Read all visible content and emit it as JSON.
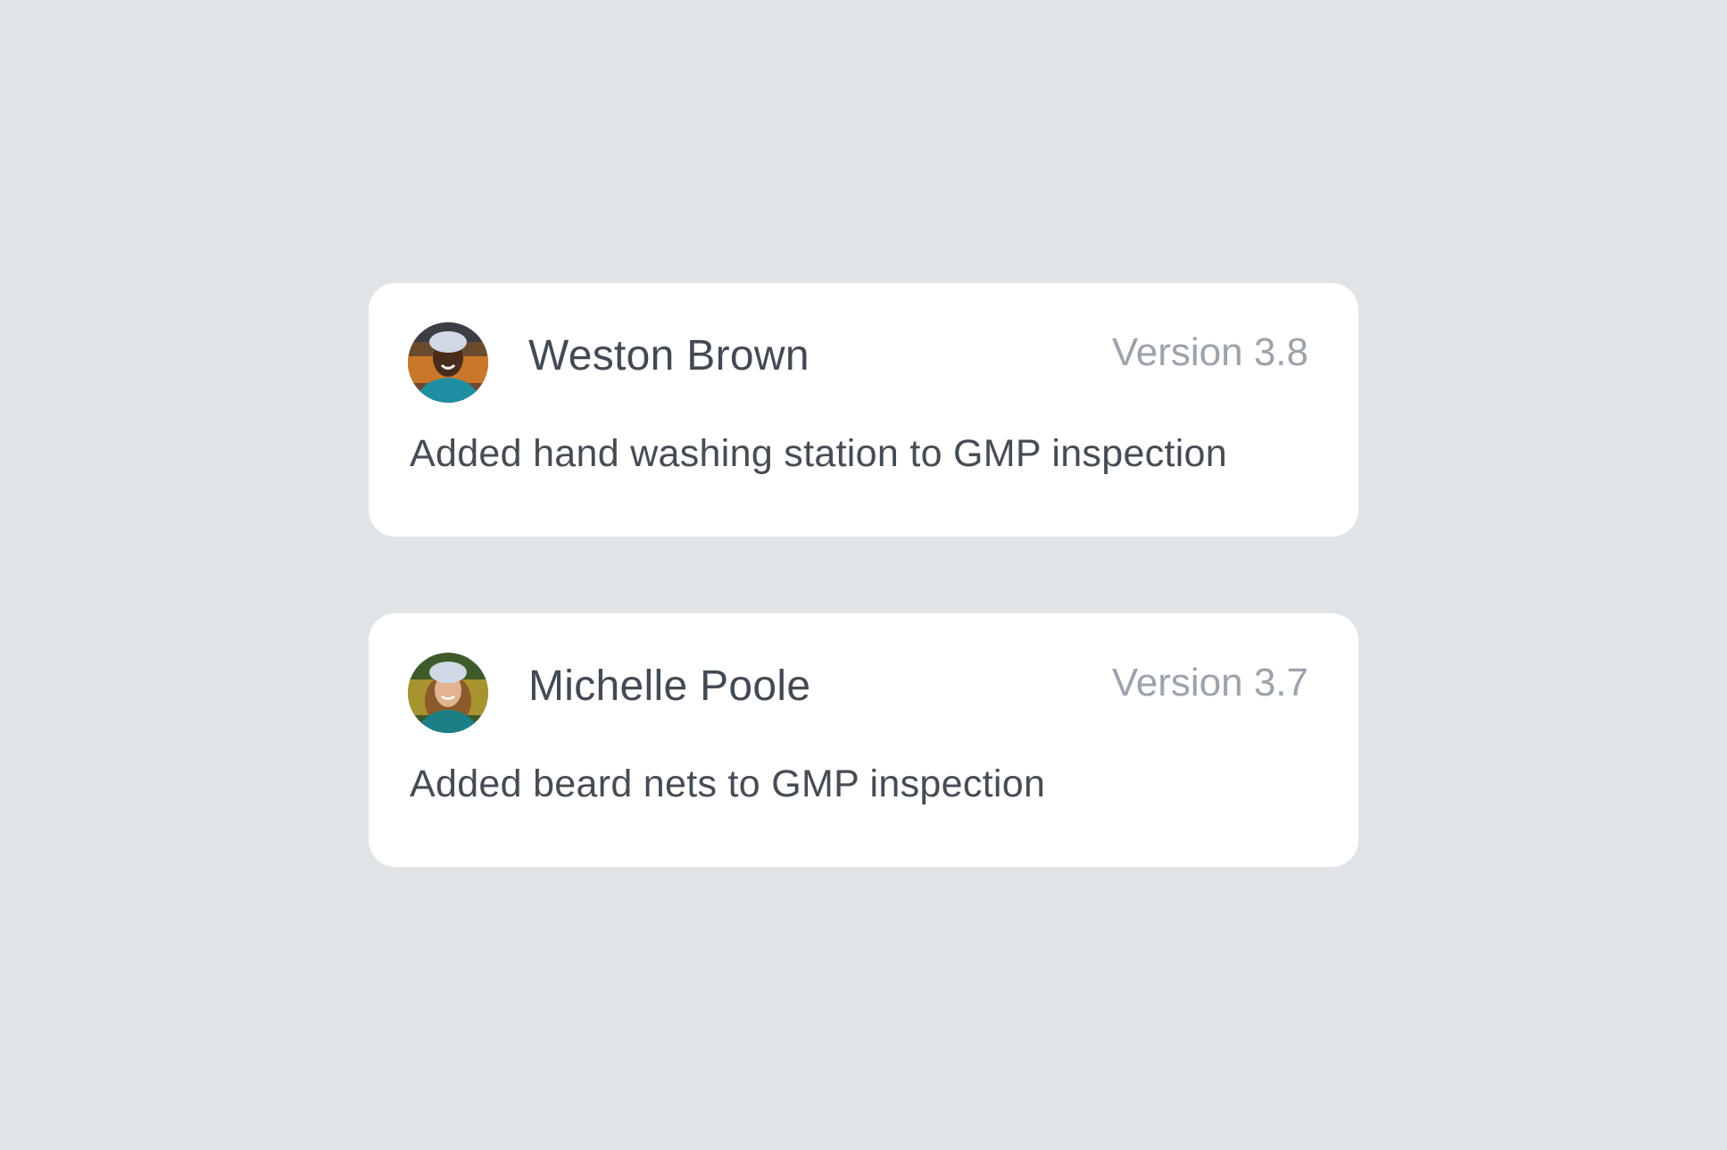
{
  "entries": [
    {
      "author": "Weston Brown",
      "version": "Version 3.8",
      "message": "Added hand washing station to GMP inspection"
    },
    {
      "author": "Michelle Poole",
      "version": "Version 3.7",
      "message": "Added beard nets to GMP inspection"
    }
  ],
  "colors": {
    "background": "#e0e4e7",
    "card": "#ffffff",
    "author_text": "#434a53",
    "version_text": "#9ca3ab",
    "message_text": "#464c54"
  }
}
